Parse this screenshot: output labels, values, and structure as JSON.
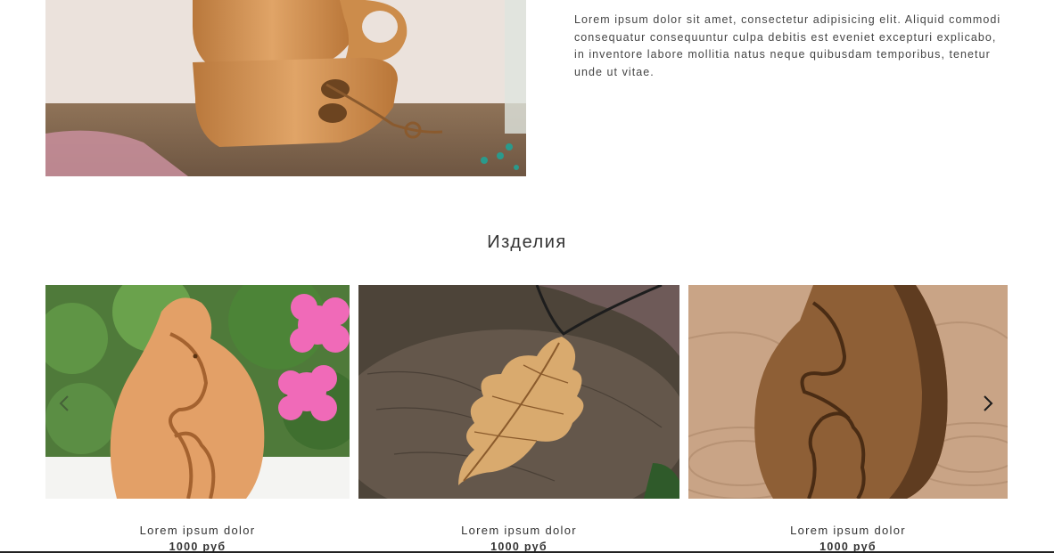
{
  "about": {
    "text": "Lorem ipsum dolor sit amet, consectetur adipisicing elit. Aliquid commodi consequatur consequuntur culpa debitis est eveniet excepturi explicabo, in inventore labore mollitia natus neque quibusdam temporibus, tenetur unde ut vitae."
  },
  "products": {
    "title": "Изделия",
    "items": [
      {
        "name": "Lorem ipsum dolor",
        "price": "1000 руб"
      },
      {
        "name": "Lorem ipsum dolor",
        "price": "1000 руб"
      },
      {
        "name": "Lorem ipsum dolor",
        "price": "1000 руб"
      }
    ],
    "nav": {
      "prev_icon": "chevron-left-icon",
      "next_icon": "chevron-right-icon"
    }
  },
  "colors": {
    "text": "#333333",
    "wood": "#c98a4a",
    "accent_pink": "#f06ab8"
  }
}
